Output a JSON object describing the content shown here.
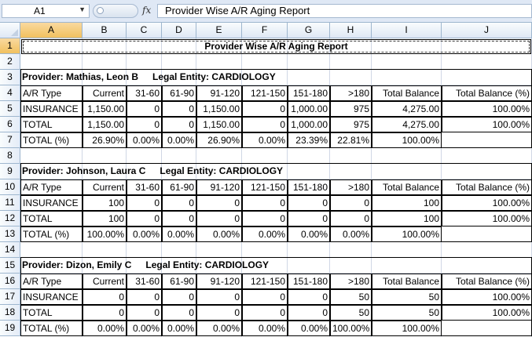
{
  "formula_bar": {
    "name_box": "A1",
    "fx_label": "fx",
    "content": "Provider Wise A/R Aging Report"
  },
  "columns": [
    "A",
    "B",
    "C",
    "D",
    "E",
    "F",
    "G",
    "H",
    "I",
    "J"
  ],
  "rows": [
    "1",
    "2",
    "3",
    "4",
    "5",
    "6",
    "7",
    "8",
    "9",
    "10",
    "11",
    "12",
    "13",
    "14",
    "15",
    "16",
    "17",
    "18",
    "19"
  ],
  "report": {
    "title": "Provider Wise A/R Aging Report",
    "headers": [
      "A/R Type",
      "Current",
      "31-60",
      "61-90",
      "91-120",
      "121-150",
      "151-180",
      ">180",
      "Total Balance",
      "Total Balance (%)"
    ],
    "providers": [
      {
        "provider_label": "Provider: Mathias, Leon B",
        "entity_label": "Legal Entity: CARDIOLOGY",
        "rows": [
          [
            "INSURANCE",
            "1,150.00",
            "0",
            "0",
            "1,150.00",
            "0",
            "1,000.00",
            "975",
            "4,275.00",
            "100.00%"
          ],
          [
            "TOTAL",
            "1,150.00",
            "0",
            "0",
            "1,150.00",
            "0",
            "1,000.00",
            "975",
            "4,275.00",
            "100.00%"
          ],
          [
            "TOTAL (%)",
            "26.90%",
            "0.00%",
            "0.00%",
            "26.90%",
            "0.00%",
            "23.39%",
            "22.81%",
            "100.00%",
            ""
          ]
        ]
      },
      {
        "provider_label": "Provider: Johnson, Laura C",
        "entity_label": "Legal Entity: CARDIOLOGY",
        "rows": [
          [
            "INSURANCE",
            "100",
            "0",
            "0",
            "0",
            "0",
            "0",
            "0",
            "100",
            "100.00%"
          ],
          [
            "TOTAL",
            "100",
            "0",
            "0",
            "0",
            "0",
            "0",
            "0",
            "100",
            "100.00%"
          ],
          [
            "TOTAL (%)",
            "100.00%",
            "0.00%",
            "0.00%",
            "0.00%",
            "0.00%",
            "0.00%",
            "0.00%",
            "100.00%",
            ""
          ]
        ]
      },
      {
        "provider_label": "Provider: Dizon, Emily C",
        "entity_label": "Legal Entity: CARDIOLOGY",
        "rows": [
          [
            "INSURANCE",
            "0",
            "0",
            "0",
            "0",
            "0",
            "0",
            "50",
            "50",
            "100.00%"
          ],
          [
            "TOTAL",
            "0",
            "0",
            "0",
            "0",
            "0",
            "0",
            "50",
            "50",
            "100.00%"
          ],
          [
            "TOTAL (%)",
            "0.00%",
            "0.00%",
            "0.00%",
            "0.00%",
            "0.00%",
            "0.00%",
            "100.00%",
            "100.00%",
            ""
          ]
        ]
      }
    ]
  }
}
